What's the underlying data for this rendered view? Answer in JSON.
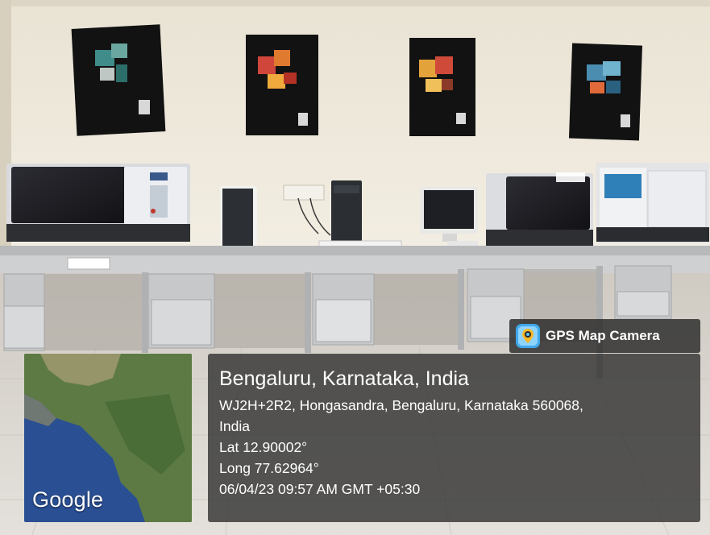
{
  "photo": {
    "scene": "computer lab"
  },
  "gps_stamp": {
    "app_name": "GPS Map Camera",
    "map_brand": "Google",
    "city_line": "Bengaluru, Karnataka, India",
    "address_line_1": "WJ2H+2R2, Hongasandra, Bengaluru, Karnataka 560068,",
    "address_line_2": "India",
    "latitude": "Lat 12.90002°",
    "longitude": "Long 77.62964°",
    "datetime": "06/04/23 09:57 AM GMT +05:30"
  },
  "colors": {
    "wall": "#efe8d8",
    "floor": "#dcd9d3",
    "overlay": "#303030",
    "ocean": "#2a4f93",
    "land": "#5d7a45"
  }
}
